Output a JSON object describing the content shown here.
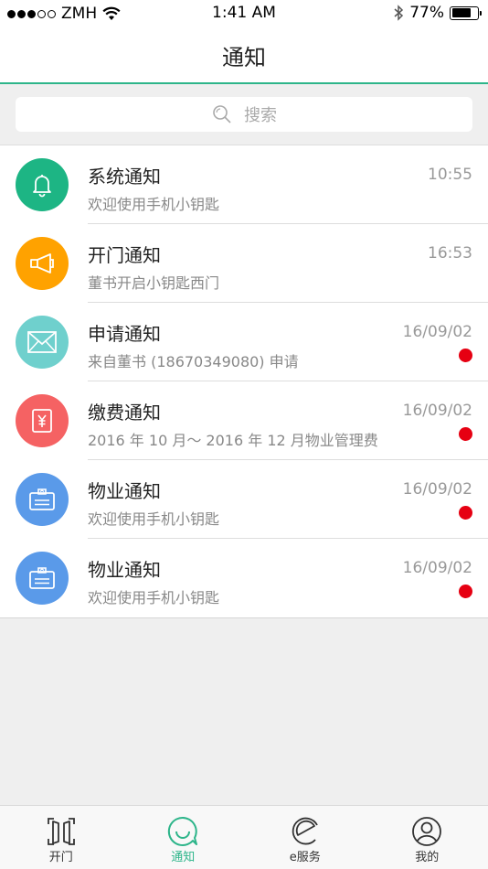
{
  "status_bar": {
    "carrier": "ZMH",
    "time": "1:41 AM",
    "battery_text": "77%",
    "battery_level": 0.77
  },
  "nav": {
    "title": "通知"
  },
  "search": {
    "placeholder": "搜索"
  },
  "notifications": [
    {
      "title": "系统通知",
      "subtitle": "欢迎使用手机小钥匙",
      "time": "10:55",
      "unread": false,
      "icon": "bell-icon",
      "color": "#1db584"
    },
    {
      "title": "开门通知",
      "subtitle": "董书开启小钥匙西门",
      "time": "16:53",
      "unread": false,
      "icon": "megaphone-icon",
      "color": "#ffa200"
    },
    {
      "title": "申请通知",
      "subtitle": "来自董书 (18670349080) 申请",
      "time": "16/09/02",
      "unread": true,
      "icon": "envelope-icon",
      "color": "#6fd0cd"
    },
    {
      "title": "缴费通知",
      "subtitle": "2016 年 10 月～ 2016 年 12 月物业管理费",
      "time": "16/09/02",
      "unread": true,
      "icon": "yen-icon",
      "color": "#f56263"
    },
    {
      "title": "物业通知",
      "subtitle": "欢迎使用手机小钥匙",
      "time": "16/09/02",
      "unread": true,
      "icon": "clipboard-icon",
      "color": "#5a9ae9"
    },
    {
      "title": "物业通知",
      "subtitle": "欢迎使用手机小钥匙",
      "time": "16/09/02",
      "unread": true,
      "icon": "clipboard-icon",
      "color": "#5a9ae9"
    }
  ],
  "tabs": [
    {
      "label": "开门",
      "icon": "door-scan-icon",
      "active": false
    },
    {
      "label": "通知",
      "icon": "chat-smile-icon",
      "active": true
    },
    {
      "label": "e服务",
      "icon": "e-service-icon",
      "active": false
    },
    {
      "label": "我的",
      "icon": "user-icon",
      "active": false
    }
  ],
  "colors": {
    "accent": "#2db58a",
    "unread": "#e60012"
  }
}
